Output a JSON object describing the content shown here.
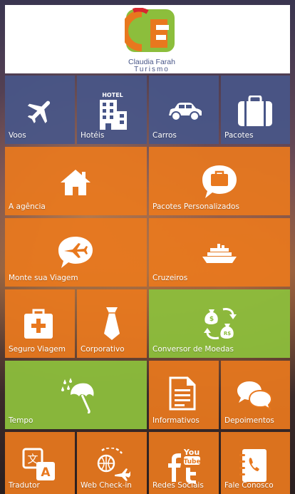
{
  "brand": {
    "logo_letters": "CF",
    "name_line1": "Claudia Farah",
    "name_line2": "Turismo",
    "colors": {
      "orange": "#e8781e",
      "green": "#8cbe3c",
      "blue": "#485688",
      "red": "#d8262f"
    }
  },
  "tiles": {
    "voos": {
      "label": "Voos",
      "icon": "airplane-icon"
    },
    "hoteis": {
      "label": "Hotéis",
      "icon": "hotel-icon",
      "icon_text": "HOTEL"
    },
    "carros": {
      "label": "Carros",
      "icon": "car-icon"
    },
    "pacotes": {
      "label": "Pacotes",
      "icon": "suitcase-icon"
    },
    "agencia": {
      "label": "A agência",
      "icon": "home-icon"
    },
    "pacotes_personalizados": {
      "label": "Pacotes Personalizados",
      "icon": "suitcase-chat-icon"
    },
    "monte_viagem": {
      "label": "Monte sua Viagem",
      "icon": "airplane-chat-icon"
    },
    "cruzeiros": {
      "label": "Cruzeiros",
      "icon": "ship-icon"
    },
    "seguro_viagem": {
      "label": "Seguro Viagem",
      "icon": "first-aid-kit-icon"
    },
    "corporativo": {
      "label": "Corporativo",
      "icon": "tie-icon"
    },
    "conversor_moedas": {
      "label": "Conversor de Moedas",
      "icon": "currency-exchange-icon",
      "icon_text": "R$"
    },
    "tempo": {
      "label": "Tempo",
      "icon": "umbrella-rain-icon"
    },
    "informativos": {
      "label": "Informativos",
      "icon": "document-icon"
    },
    "depoimentos": {
      "label": "Depoimentos",
      "icon": "chat-bubbles-icon"
    },
    "tradutor": {
      "label": "Tradutor",
      "icon": "translate-icon",
      "icon_text": "A"
    },
    "web_checkin": {
      "label": "Web Check-in",
      "icon": "globe-airplane-icon"
    },
    "redes_sociais": {
      "label": "Redes Sociais",
      "icon": "social-icon",
      "icon_text": "You Tube"
    },
    "fale_conosco": {
      "label": "Fale Conosco",
      "icon": "phone-book-icon"
    }
  }
}
